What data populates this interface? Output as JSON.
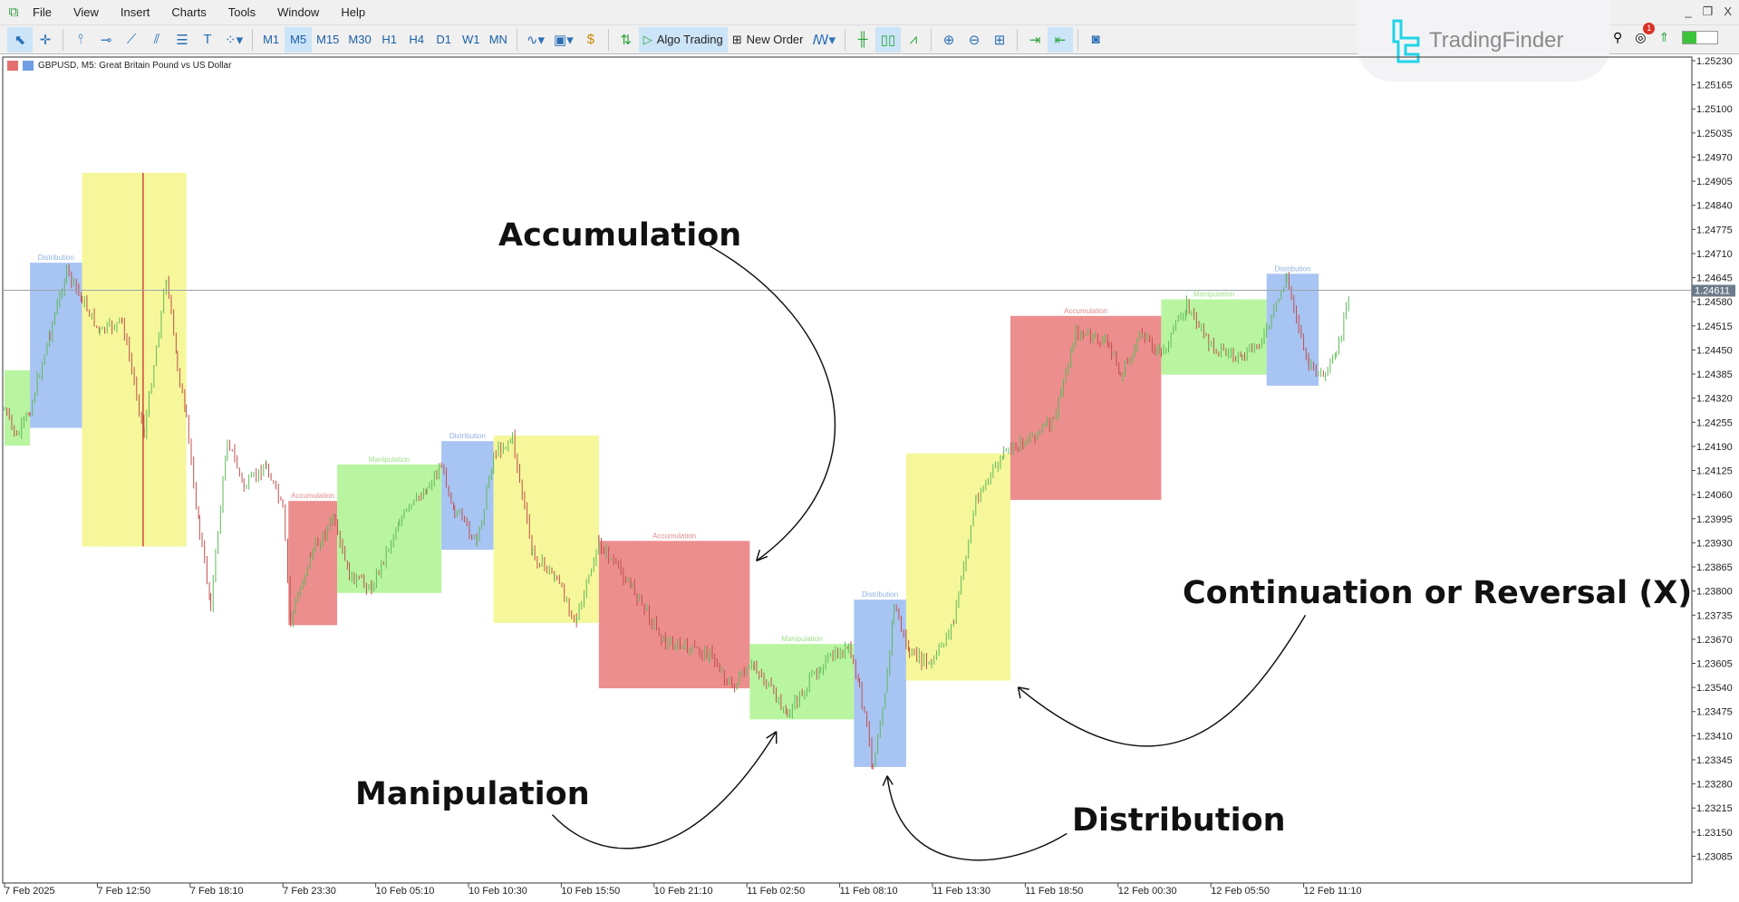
{
  "menu": {
    "items": [
      "File",
      "View",
      "Insert",
      "Charts",
      "Tools",
      "Window",
      "Help"
    ]
  },
  "window_controls": [
    "_",
    "❐",
    "X"
  ],
  "toolbar": {
    "timeframes": [
      "M1",
      "M5",
      "M15",
      "M30",
      "H1",
      "H4",
      "D1",
      "W1",
      "MN"
    ],
    "active_timeframe": "M5",
    "algo_trading_label": "Algo Trading",
    "new_order_label": "New Order",
    "notification_count": "1"
  },
  "watermark": {
    "brand": "TradingFinder"
  },
  "chart": {
    "header": "GBPUSD, M5:  Great Britain Pound vs US Dollar",
    "current_price": "1.24611",
    "price_ticks": [
      "1.25230",
      "1.25165",
      "1.25100",
      "1.25035",
      "1.24970",
      "1.24905",
      "1.24840",
      "1.24775",
      "1.24710",
      "1.24645",
      "1.24580",
      "1.24515",
      "1.24450",
      "1.24385",
      "1.24320",
      "1.24255",
      "1.24190",
      "1.24125",
      "1.24060",
      "1.23995",
      "1.23930",
      "1.23865",
      "1.23800",
      "1.23735",
      "1.23670",
      "1.23605",
      "1.23540",
      "1.23475",
      "1.23410",
      "1.23345",
      "1.23280",
      "1.23215",
      "1.23150",
      "1.23085"
    ],
    "time_ticks": [
      "7 Feb 2025",
      "7 Feb 12:50",
      "7 Feb 18:10",
      "7 Feb 23:30",
      "10 Feb 05:10",
      "10 Feb 10:30",
      "10 Feb 15:50",
      "10 Feb 21:10",
      "11 Feb 02:50",
      "11 Feb 08:10",
      "11 Feb 13:30",
      "11 Feb 18:50",
      "12 Feb 00:30",
      "12 Feb 05:50",
      "12 Feb 11:10"
    ],
    "colors": {
      "accumulation": "#ec8e8e",
      "manipulation": "#b9f5a0",
      "distribution": "#a8c4f2",
      "yellow_zone": "#f5f79a",
      "bull": "#5fb85a",
      "bear": "#c0504d"
    },
    "zones": [
      {
        "type": "manipulation",
        "label": ""
      },
      {
        "type": "distribution",
        "label": "Distribution"
      },
      {
        "type": "yellow_zone",
        "label": ""
      },
      {
        "type": "accumulation",
        "label": "Accumulation"
      },
      {
        "type": "manipulation",
        "label": "Manipulation"
      },
      {
        "type": "distribution",
        "label": "Distribution"
      },
      {
        "type": "yellow_zone",
        "label": ""
      },
      {
        "type": "accumulation",
        "label": "Accumulation"
      },
      {
        "type": "manipulation",
        "label": "Manipulation"
      },
      {
        "type": "distribution",
        "label": "Distribution"
      },
      {
        "type": "yellow_zone",
        "label": ""
      },
      {
        "type": "accumulation",
        "label": "Accumulation"
      },
      {
        "type": "manipulation",
        "label": "Manipulation"
      },
      {
        "type": "distribution",
        "label": "Distribution"
      }
    ]
  },
  "annotations": {
    "accumulation": "Accumulation",
    "manipulation": "Manipulation",
    "distribution": "Distribution",
    "continuation": "Continuation or Reversal (X)"
  }
}
